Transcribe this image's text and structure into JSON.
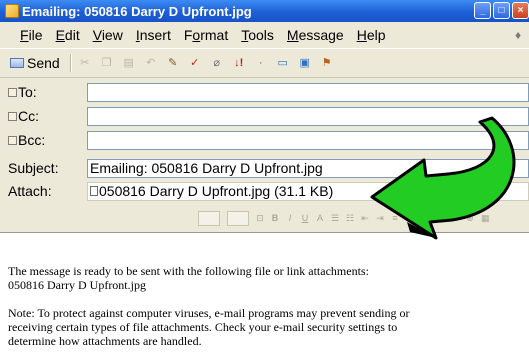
{
  "window": {
    "title": "Emailing: 050816 Darry D Upfront.jpg",
    "title_bar_color": "#1d5fd6",
    "buttons": [
      "minimize-icon",
      "maximize-icon",
      "close-icon"
    ]
  },
  "menu": {
    "items": [
      {
        "mnemonic": "F",
        "rest": "ile"
      },
      {
        "mnemonic": "E",
        "rest": "dit"
      },
      {
        "mnemonic": "V",
        "rest": "iew"
      },
      {
        "mnemonic": "I",
        "rest": "nsert"
      },
      {
        "prefix": "F",
        "mnemonic": "o",
        "rest": "rmat"
      },
      {
        "mnemonic": "T",
        "rest": "ools"
      },
      {
        "mnemonic": "M",
        "rest": "essage"
      },
      {
        "mnemonic": "H",
        "rest": "elp"
      }
    ]
  },
  "toolbar": {
    "send_label": "Send",
    "icons": [
      "cut-icon",
      "copy-icon",
      "paste-icon",
      "undo-icon",
      "check-names-icon",
      "spelling-icon",
      "attach-icon",
      "priority-icon",
      "sign-icon",
      "encrypt-icon",
      "offline-icon"
    ]
  },
  "headers": {
    "to_label": "To:",
    "cc_label": "Cc:",
    "bcc_label": "Bcc:",
    "subject_label": "Subject:",
    "subject_value": "Emailing: 050816 Darry D Upfront.jpg",
    "attach_label": "Attach:",
    "attachment": "050816 Darry D Upfront.jpg (31.1 KB)"
  },
  "body": {
    "line1": "The message is ready to be sent with the following file or link attachments:",
    "line2": "050816 Darry D Upfront.jpg",
    "note1": "Note: To protect against computer viruses, e-mail programs may prevent sending or",
    "note2": "receiving certain types of file attachments.  Check your e-mail security settings to",
    "note3": "determine how attachments are handled."
  },
  "annotation": {
    "arrow_color": "#22cc22",
    "arrow_outline": "#000000",
    "points_to": "attachment"
  }
}
